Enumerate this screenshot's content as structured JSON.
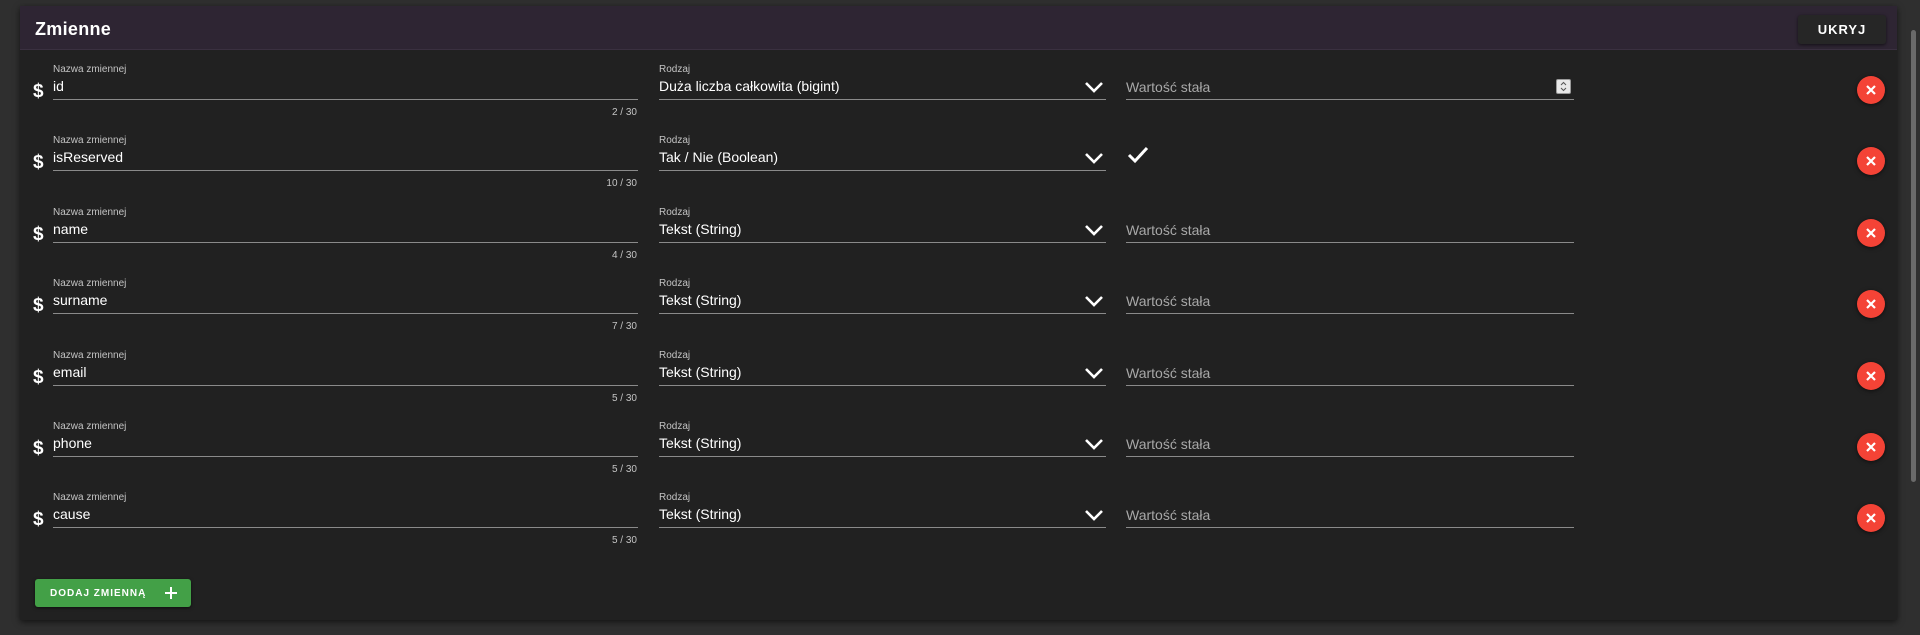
{
  "panel": {
    "title": "Zmienne",
    "hide_label": "UKRYJ"
  },
  "labels": {
    "name_label": "Nazwa zmiennej",
    "type_label": "Rodzaj",
    "value_placeholder": "Wartość stała",
    "dollar": "$"
  },
  "variables": [
    {
      "name": "id",
      "counter": "2 / 30",
      "type": "Duża liczba całkowita (bigint)",
      "value_kind": "number"
    },
    {
      "name": "isReserved",
      "counter": "10 / 30",
      "type": "Tak / Nie (Boolean)",
      "value_kind": "boolean",
      "checked": true
    },
    {
      "name": "name",
      "counter": "4 / 30",
      "type": "Tekst (String)",
      "value_kind": "text"
    },
    {
      "name": "surname",
      "counter": "7 / 30",
      "type": "Tekst (String)",
      "value_kind": "text"
    },
    {
      "name": "email",
      "counter": "5 / 30",
      "type": "Tekst (String)",
      "value_kind": "text"
    },
    {
      "name": "phone",
      "counter": "5 / 30",
      "type": "Tekst (String)",
      "value_kind": "text"
    },
    {
      "name": "cause",
      "counter": "5 / 30",
      "type": "Tekst (String)",
      "value_kind": "text"
    }
  ],
  "add_button": {
    "label": "DODAJ ZMIENNĄ"
  },
  "colors": {
    "header_bg": "#2e2533",
    "panel_bg": "#212121",
    "delete": "#f44336",
    "add": "#43a047"
  },
  "icons": {
    "dollar": "dollar-icon",
    "chevron": "chevron-down-icon",
    "check": "check-icon",
    "delete": "close-icon",
    "add": "plus-icon"
  }
}
